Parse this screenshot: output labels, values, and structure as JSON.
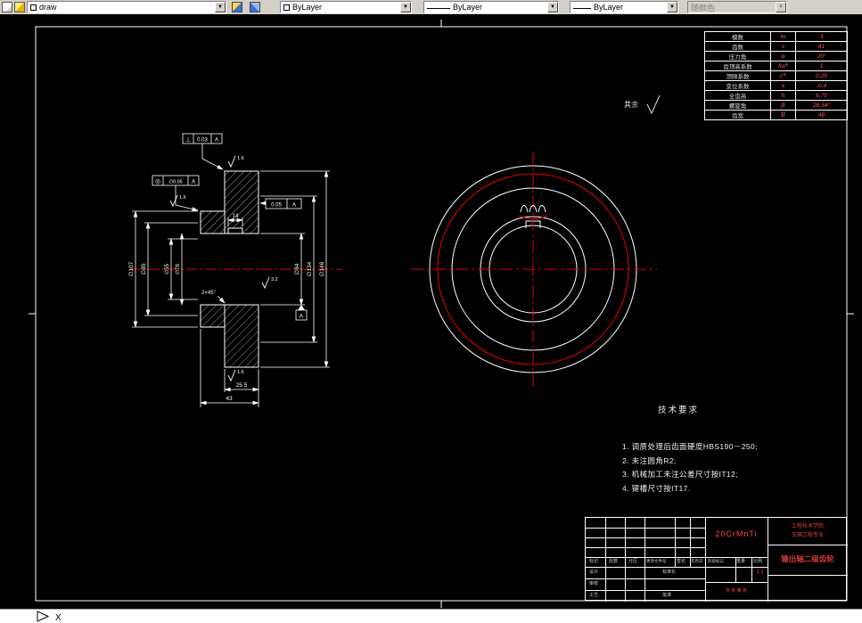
{
  "toolbar": {
    "layer_value": "draw",
    "color_value": "ByLayer",
    "linetype_value": "ByLayer",
    "lineweight_value": "ByLayer",
    "plotstyle_value": "随颜色"
  },
  "gear_table": {
    "rows": [
      {
        "label": "模数",
        "symbol": "m",
        "value": "3"
      },
      {
        "label": "齿数",
        "symbol": "z",
        "value": "41"
      },
      {
        "label": "压力角",
        "symbol": "α",
        "value": "20°"
      },
      {
        "label": "齿顶高系数",
        "symbol": "ha*",
        "value": "1"
      },
      {
        "label": "顶隙系数",
        "symbol": "c*",
        "value": "0.25"
      },
      {
        "label": "变位系数",
        "symbol": "x",
        "value": "-0.4"
      },
      {
        "label": "全齿高",
        "symbol": "h",
        "value": "6.75"
      },
      {
        "label": "螺旋角",
        "symbol": "β",
        "value": "28.54°"
      },
      {
        "label": "齿宽",
        "symbol": "B",
        "value": "48"
      }
    ]
  },
  "tech_req": {
    "title": "技术要求",
    "lines": [
      "1. 调质处理后齿面硬度HBS190－250;",
      "2. 未注圆角R2;",
      "3. 机械加工未注公差尺寸按IT12;",
      "4. 键槽尺寸按IT17."
    ]
  },
  "annotations": {
    "surface_default": "其余",
    "fcf1": {
      "sym": "⊥",
      "tol": "0.03",
      "datum": "A"
    },
    "fcf2": {
      "sym": "◎",
      "tol": "∅0.05",
      "datum": "A"
    },
    "fcf3": {
      "tol": "0.05",
      "datum": "A"
    },
    "datum_label": "A",
    "dims": {
      "d_left_outer": "∅107",
      "d_left_hub": "∅85",
      "d_bore_small": "∅55",
      "d_bore_mid": "∅76",
      "d_bore": "∅84",
      "d_rim_inner": "∅134",
      "d_outer": "∅146",
      "key_width": "14",
      "chamfer": "2×45°",
      "rim_width": "25.5",
      "total_width": "43",
      "r1": "1.6",
      "r2": "1.6",
      "r3": "3.2",
      "r4": "1.6"
    }
  },
  "title_block": {
    "material": "20CrMnTi",
    "part_name": "输出轴二级齿轮",
    "school_line1": "工程技术学院",
    "school_line2": "车辆工程专业",
    "scale_value": "1:1",
    "sheets": "共 张  第 张",
    "labels": {
      "mark": "标记",
      "count": "处数",
      "zone": "分区",
      "change_no": "更改文件号",
      "sign": "签名",
      "date": "年月日",
      "design": "设计",
      "standard": "标准化",
      "check": "审核",
      "process": "工艺",
      "approve": "批准",
      "stage": "阶段标记",
      "weight": "重量",
      "scale": "比例"
    }
  },
  "ucs": {
    "x_label": "X"
  }
}
